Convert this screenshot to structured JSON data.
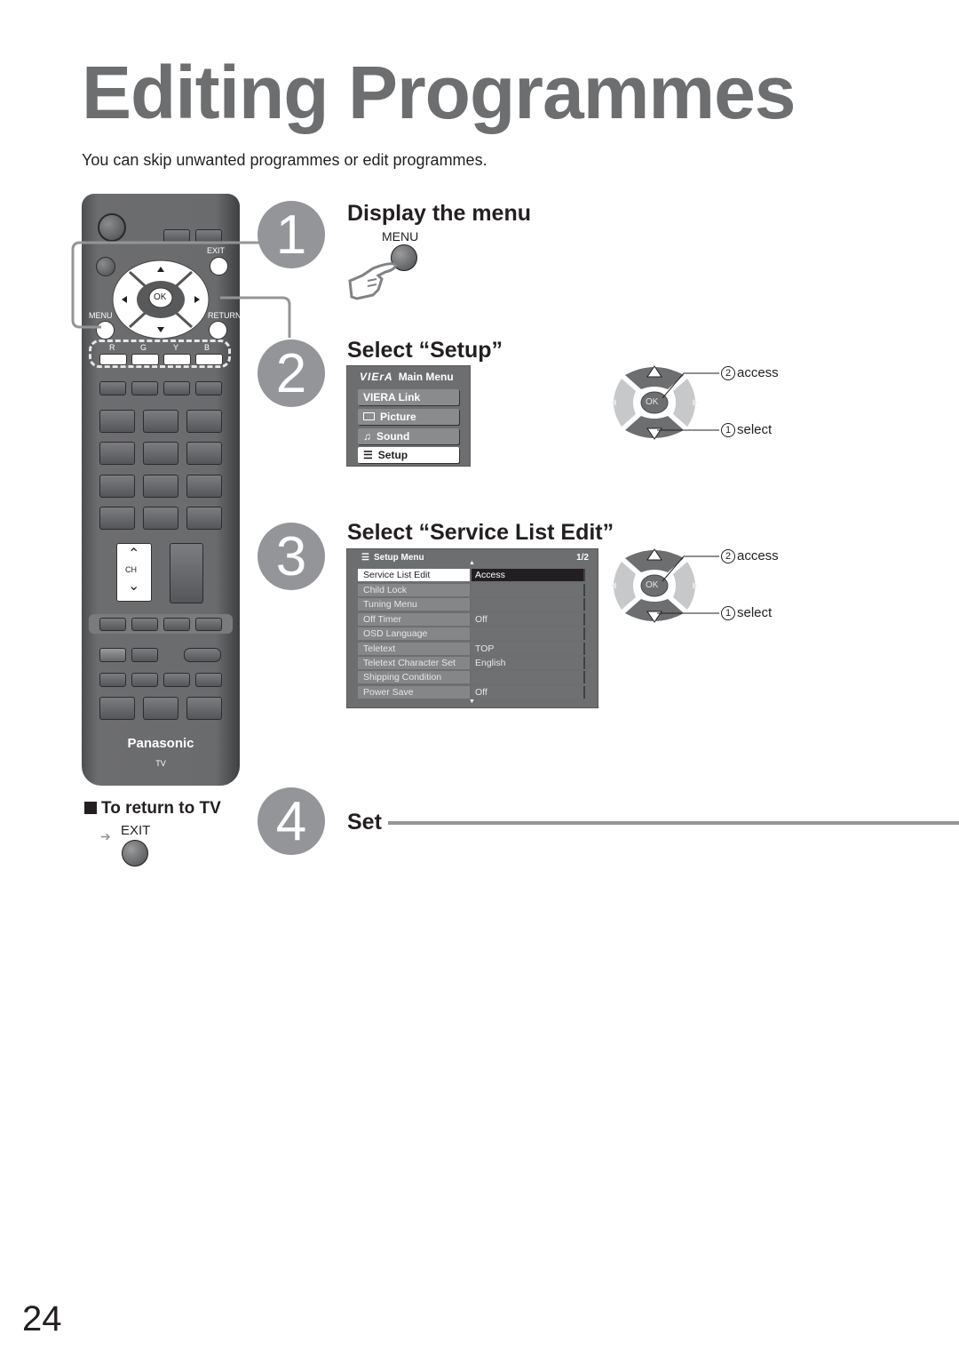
{
  "page": {
    "title": "Editing Programmes",
    "subtitle": "You can skip unwanted programmes or edit programmes.",
    "page_number": "24"
  },
  "remote": {
    "brand": "Panasonic",
    "model_label": "TV",
    "labels": {
      "exit": "EXIT",
      "menu": "MENU",
      "return": "RETURN",
      "ok": "OK",
      "r": "R",
      "g": "G",
      "y": "Y",
      "b": "B",
      "ch": "CH"
    }
  },
  "steps": [
    {
      "number": "1",
      "heading": "Display the menu",
      "button_label": "MENU"
    },
    {
      "number": "2",
      "heading": "Select “Setup”"
    },
    {
      "number": "3",
      "heading": "Select “Service List Edit”"
    },
    {
      "number": "4",
      "heading": "Set"
    }
  ],
  "main_menu": {
    "logo": "VIErA",
    "title": "Main Menu",
    "items": [
      {
        "label": "VIERA Link",
        "icon": "none",
        "selected": false
      },
      {
        "label": "Picture",
        "icon": "picture-icon",
        "selected": false
      },
      {
        "label": "Sound",
        "icon": "music-note-icon",
        "selected": false
      },
      {
        "label": "Setup",
        "icon": "list-icon",
        "selected": true
      }
    ]
  },
  "setup_menu": {
    "title": "Setup Menu",
    "page": "1/2",
    "rows": [
      {
        "label": "Service List Edit",
        "value": "Access",
        "selected": true
      },
      {
        "label": "Child Lock",
        "value": "",
        "selected": false
      },
      {
        "label": "Tuning Menu",
        "value": "",
        "selected": false
      },
      {
        "label": "Off Timer",
        "value": "Off",
        "selected": false
      },
      {
        "label": "OSD Language",
        "value": "",
        "selected": false
      },
      {
        "label": "Teletext",
        "value": "TOP",
        "selected": false
      },
      {
        "label": "Teletext Character Set",
        "value": "English",
        "selected": false
      },
      {
        "label": "Shipping Condition",
        "value": "",
        "selected": false
      },
      {
        "label": "Power Save",
        "value": "Off",
        "selected": false
      }
    ]
  },
  "dpad_callouts": {
    "ok": "OK",
    "access_num": "2",
    "access": "access",
    "select_num": "1",
    "select": "select"
  },
  "return_to_tv": {
    "heading": "To return to TV",
    "button_label": "EXIT"
  },
  "colors": {
    "title_gray": "#6d6e70",
    "step_circle": "#939598",
    "text": "#231f20",
    "menu_bg": "#6d6e70"
  }
}
